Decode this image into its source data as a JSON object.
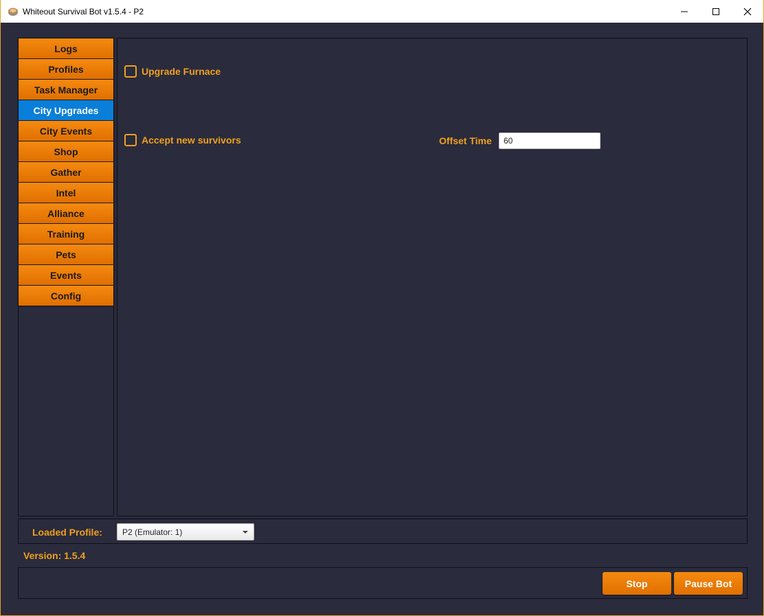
{
  "window": {
    "title": "Whiteout Survival Bot v1.5.4 - P2",
    "accent_color": "#f0a020",
    "background_color": "#2a2b3c"
  },
  "sidebar": {
    "items": [
      {
        "label": "Logs",
        "active": false
      },
      {
        "label": "Profiles",
        "active": false
      },
      {
        "label": "Task Manager",
        "active": false
      },
      {
        "label": "City Upgrades",
        "active": true
      },
      {
        "label": "City Events",
        "active": false
      },
      {
        "label": "Shop",
        "active": false
      },
      {
        "label": "Gather",
        "active": false
      },
      {
        "label": "Intel",
        "active": false
      },
      {
        "label": "Alliance",
        "active": false
      },
      {
        "label": "Training",
        "active": false
      },
      {
        "label": "Pets",
        "active": false
      },
      {
        "label": "Events",
        "active": false
      },
      {
        "label": "Config",
        "active": false
      }
    ]
  },
  "content": {
    "upgrade_furnace": {
      "label": "Upgrade Furnace",
      "checked": false
    },
    "accept_survivors": {
      "label": "Accept new survivors",
      "checked": false
    },
    "offset_time": {
      "label": "Offset Time",
      "value": "60"
    }
  },
  "profile": {
    "label": "Loaded Profile:",
    "selected": "P2 (Emulator: 1)"
  },
  "version": "Version: 1.5.4",
  "buttons": {
    "stop": "Stop",
    "pause": "Pause Bot"
  }
}
